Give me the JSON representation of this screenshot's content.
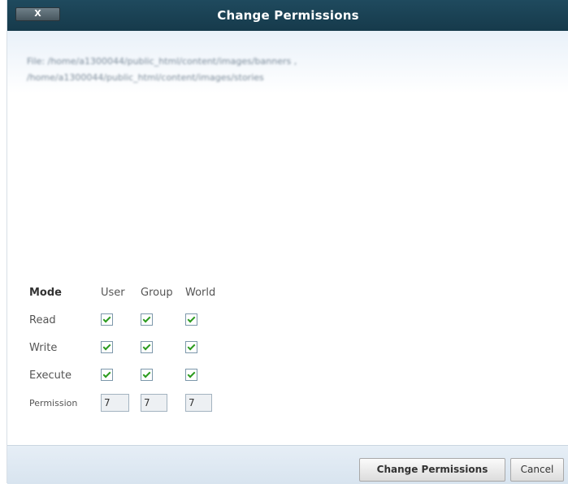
{
  "dialog": {
    "title": "Change Permissions",
    "close_label": "X",
    "file_line1": "File: /home/a1300044/public_html/content/images/banners ,",
    "file_line2": "/home/a1300044/public_html/content/images/stories"
  },
  "permissions": {
    "headers": {
      "mode": "Mode",
      "user": "User",
      "group": "Group",
      "world": "World"
    },
    "rows": [
      {
        "label": "Read",
        "user": true,
        "group": true,
        "world": true
      },
      {
        "label": "Write",
        "user": true,
        "group": true,
        "world": true
      },
      {
        "label": "Execute",
        "user": true,
        "group": true,
        "world": true
      }
    ],
    "permission_label": "Permission",
    "values": {
      "user": "7",
      "group": "7",
      "world": "7"
    }
  },
  "footer": {
    "submit_label": "Change Permissions",
    "cancel_label": "Cancel"
  }
}
